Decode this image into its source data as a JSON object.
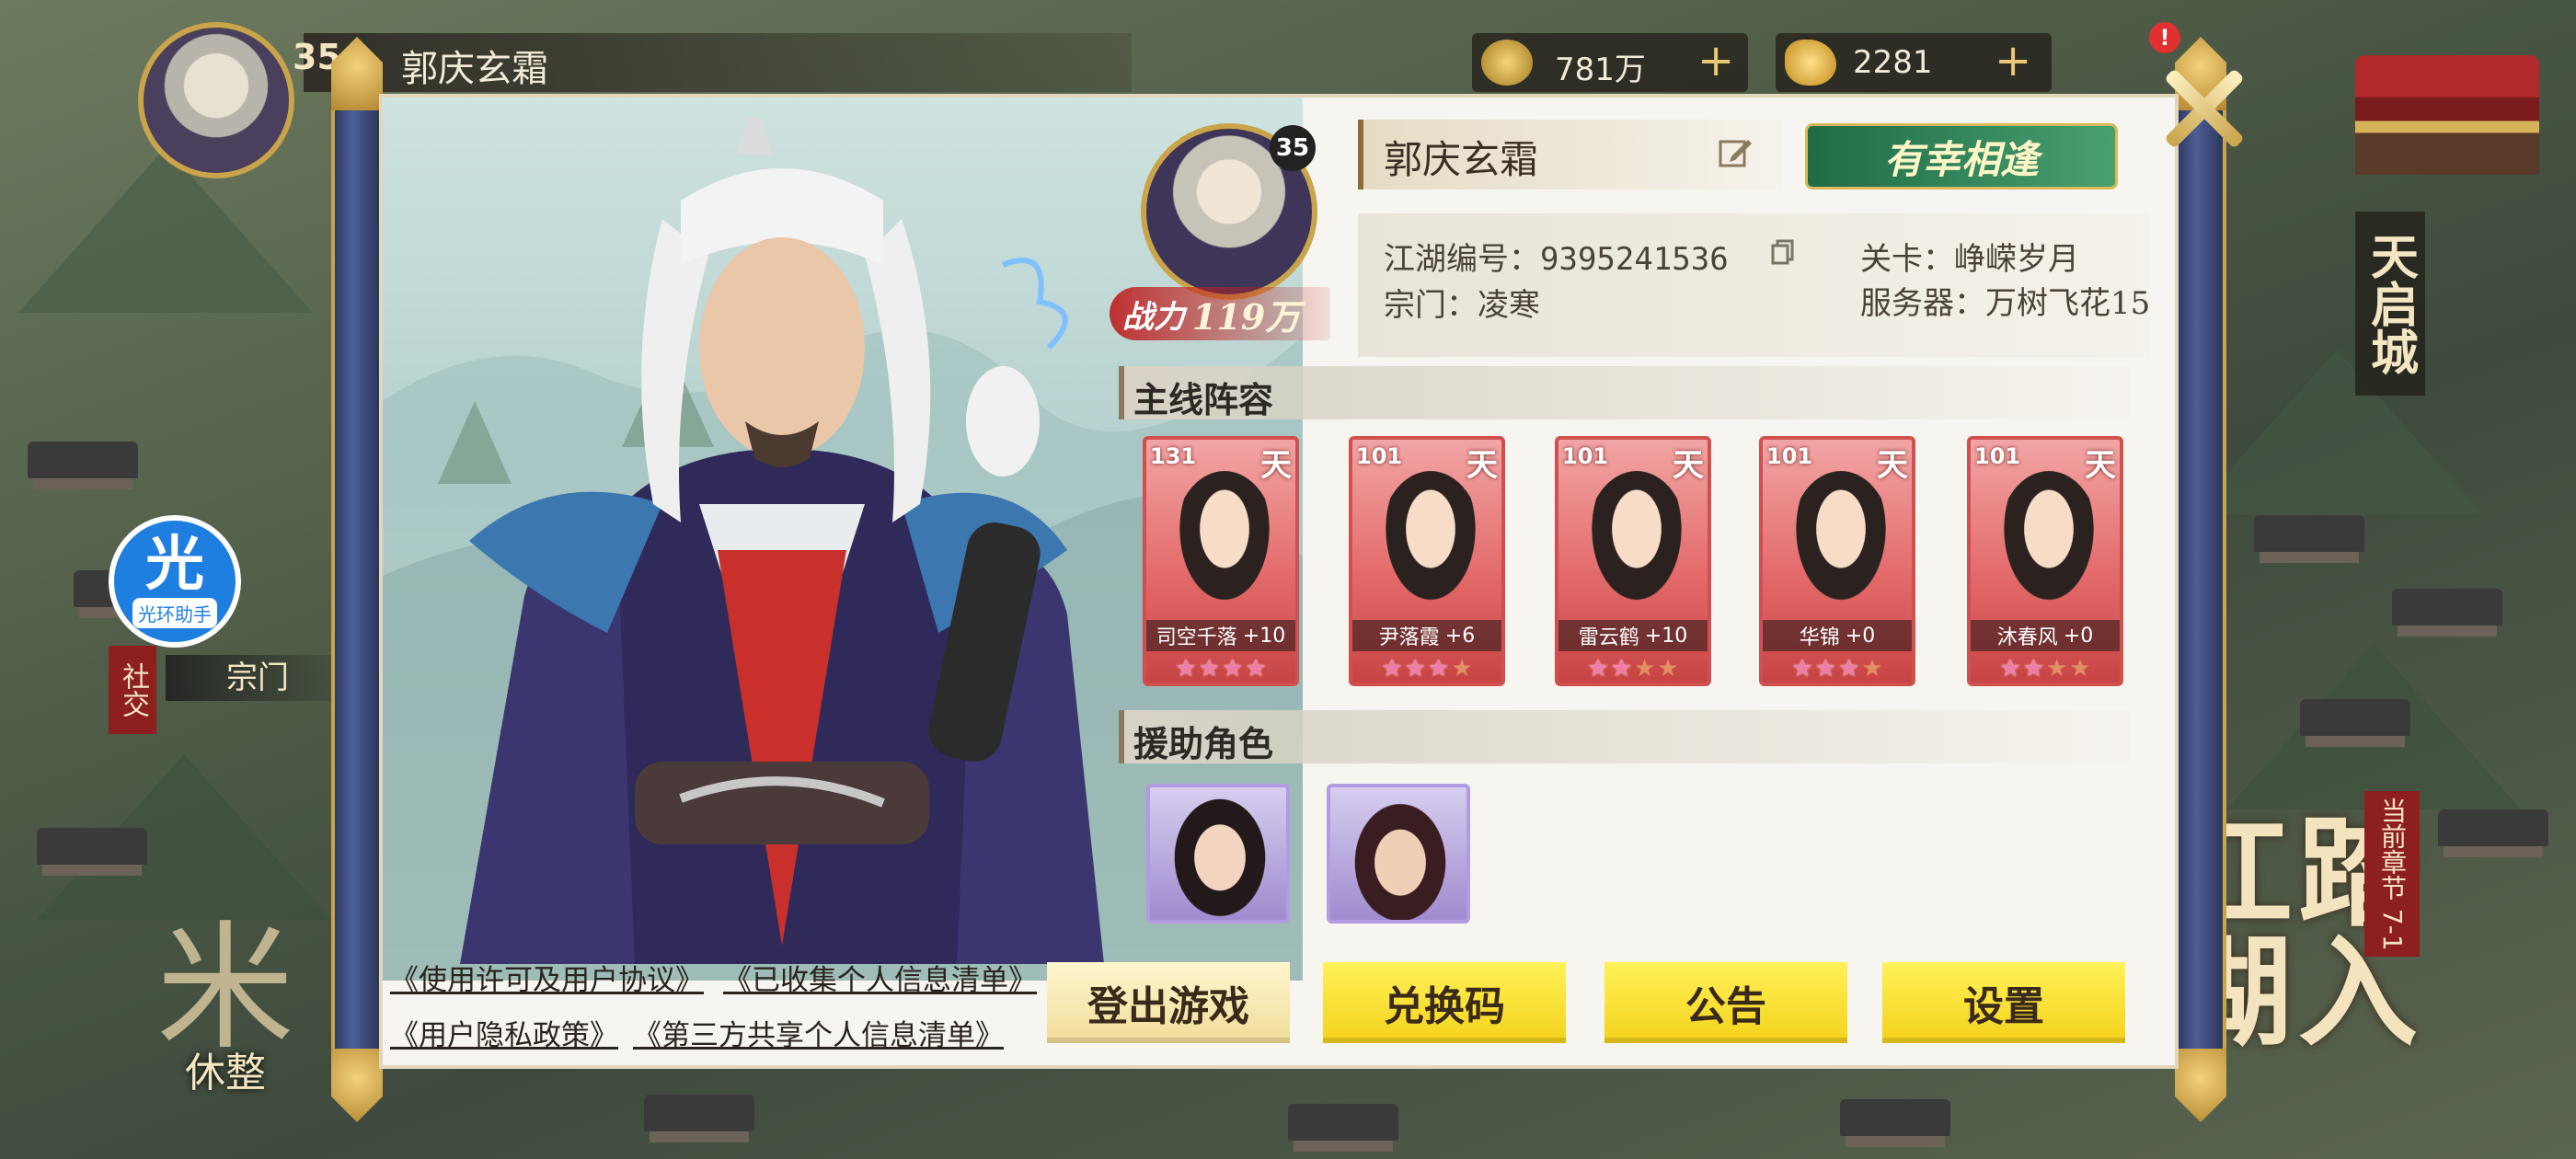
{
  "hud": {
    "level": "35",
    "player_name": "郭庆玄霜",
    "silver": "781万",
    "gold": "2281",
    "notification": "!"
  },
  "side": {
    "helper_glyph": "光",
    "helper_label": "光环助手",
    "social": "社交",
    "sect": "宗门",
    "rest_glyph": "米",
    "rest_label": "休整",
    "city": "天启城",
    "chapter_tag": "当前章节 7-1",
    "chapter_title": "踏入江湖"
  },
  "profile": {
    "level": "35",
    "power_label": "战力",
    "power_value": "119万",
    "name": "郭庆玄霜",
    "title_badge": "有幸相逢",
    "id_label": "江湖编号：",
    "id_value": "9395241536",
    "sect_label": "宗门：",
    "sect_value": "凌寒",
    "stage_label": "关卡：",
    "stage_value": "峥嵘岁月",
    "server_label": "服务器：",
    "server_value": "万树飞花15"
  },
  "lineup": {
    "title": "主线阵容",
    "grade_glyph": "天",
    "heroes": [
      {
        "level": "131",
        "name": "司空千落",
        "bonus": "+10",
        "stars": 4
      },
      {
        "level": "101",
        "name": "尹落霞",
        "bonus": "+6",
        "stars": 3
      },
      {
        "level": "101",
        "name": "雷云鹤",
        "bonus": "+10",
        "stars": 2
      },
      {
        "level": "101",
        "name": "华锦",
        "bonus": "+0",
        "stars": 3
      },
      {
        "level": "101",
        "name": "沐春风",
        "bonus": "+0",
        "stars": 2
      }
    ]
  },
  "support": {
    "title": "援助角色"
  },
  "legal": {
    "license": "《使用许可及用户协议》",
    "collected": "《已收集个人信息清单》",
    "privacy": "《用户隐私政策》",
    "third_party": "《第三方共享个人信息清单》"
  },
  "actions": {
    "logout": "登出游戏",
    "redeem": "兑换码",
    "notice": "公告",
    "settings": "设置"
  },
  "colors": {
    "panel": "#f7f5ef",
    "scroll_rod": "#3c4a7a",
    "gold_trim": "#c9a44a",
    "button_yellow": "#f4d21a",
    "hero_card": "#e46b6b",
    "support_card": "#b29be0"
  }
}
